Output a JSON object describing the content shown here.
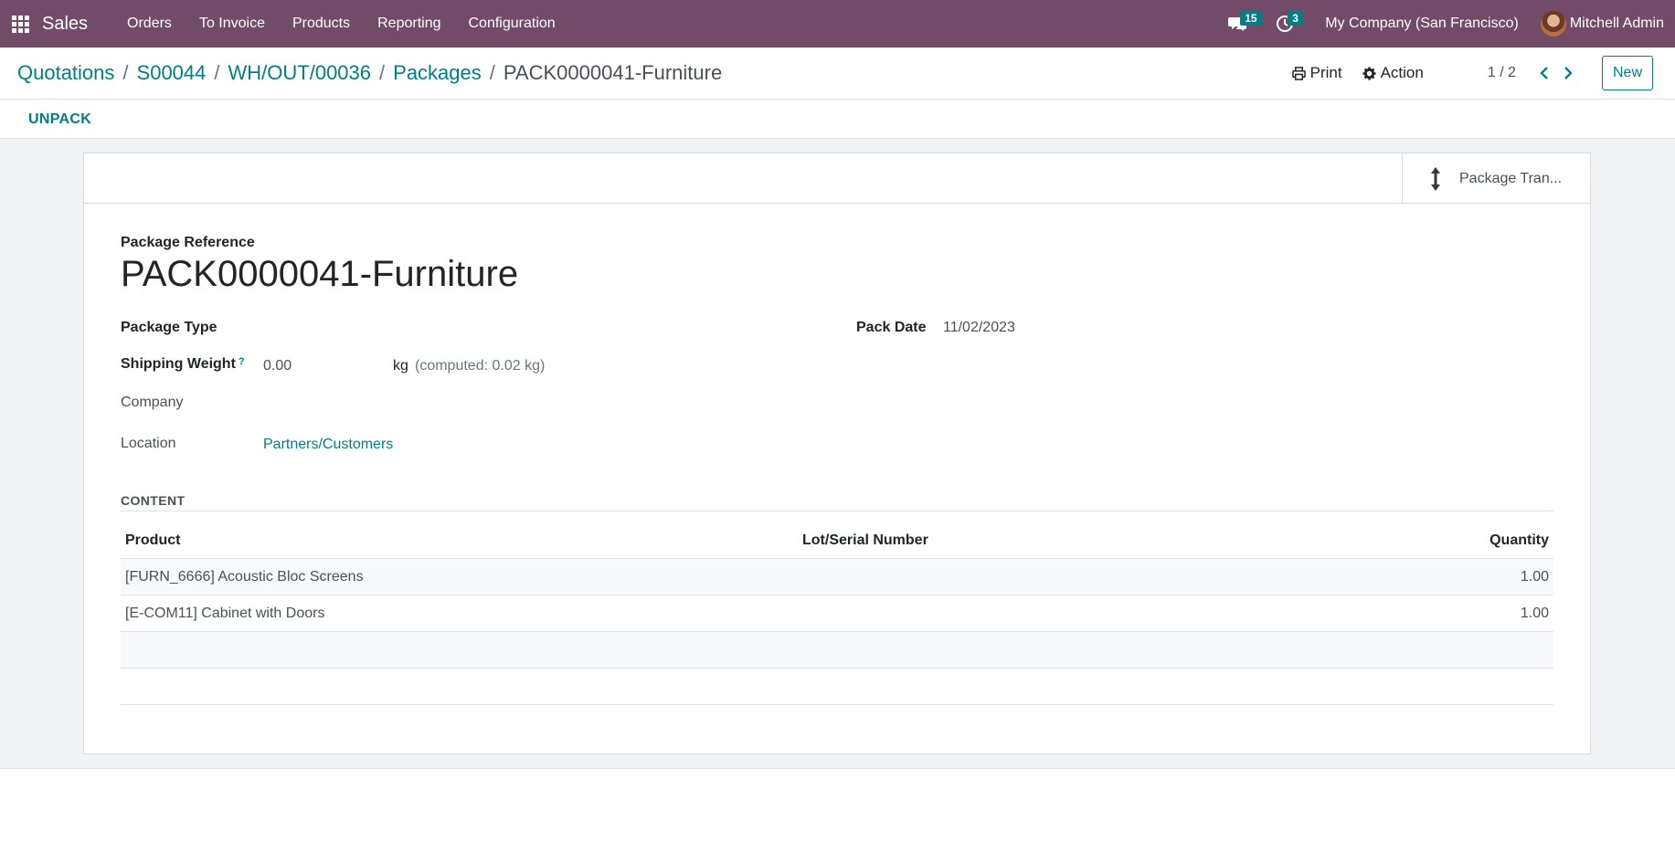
{
  "navbar": {
    "app_name": "Sales",
    "menu": [
      "Orders",
      "To Invoice",
      "Products",
      "Reporting",
      "Configuration"
    ],
    "messages_count": "15",
    "activities_count": "3",
    "company": "My Company (San Francisco)",
    "user": "Mitchell Admin",
    "color": "#714B67"
  },
  "breadcrumb": {
    "items": [
      "Quotations",
      "S00044",
      "WH/OUT/00036",
      "Packages"
    ],
    "current": "PACK0000041-Furniture"
  },
  "toolbar": {
    "print_label": "Print",
    "action_label": "Action",
    "pager": "1 / 2",
    "new_label": "New"
  },
  "statusbar": {
    "unpack_label": "UNPACK"
  },
  "smart_buttons": {
    "package_transfers": "Package Tran..."
  },
  "form": {
    "reference_label": "Package Reference",
    "reference": "PACK0000041-Furniture",
    "package_type_label": "Package Type",
    "package_type": "",
    "pack_date_label": "Pack Date",
    "pack_date": "11/02/2023",
    "shipping_weight_label": "Shipping Weight",
    "shipping_weight_help": "?",
    "shipping_weight": "0.00",
    "weight_unit": "kg",
    "computed_weight": "(computed: 0.02  kg)",
    "company_label": "Company",
    "company": "",
    "location_label": "Location",
    "location": "Partners/Customers"
  },
  "content": {
    "section_title": "CONTENT",
    "columns": [
      "Product",
      "Lot/Serial Number",
      "Quantity"
    ],
    "rows": [
      {
        "product": "[FURN_6666] Acoustic Bloc Screens",
        "lot": "",
        "quantity": "1.00"
      },
      {
        "product": "[E-COM11] Cabinet with Doors",
        "lot": "",
        "quantity": "1.00"
      }
    ]
  },
  "colors": {
    "accent": "#017E84",
    "brand": "#714B67"
  }
}
